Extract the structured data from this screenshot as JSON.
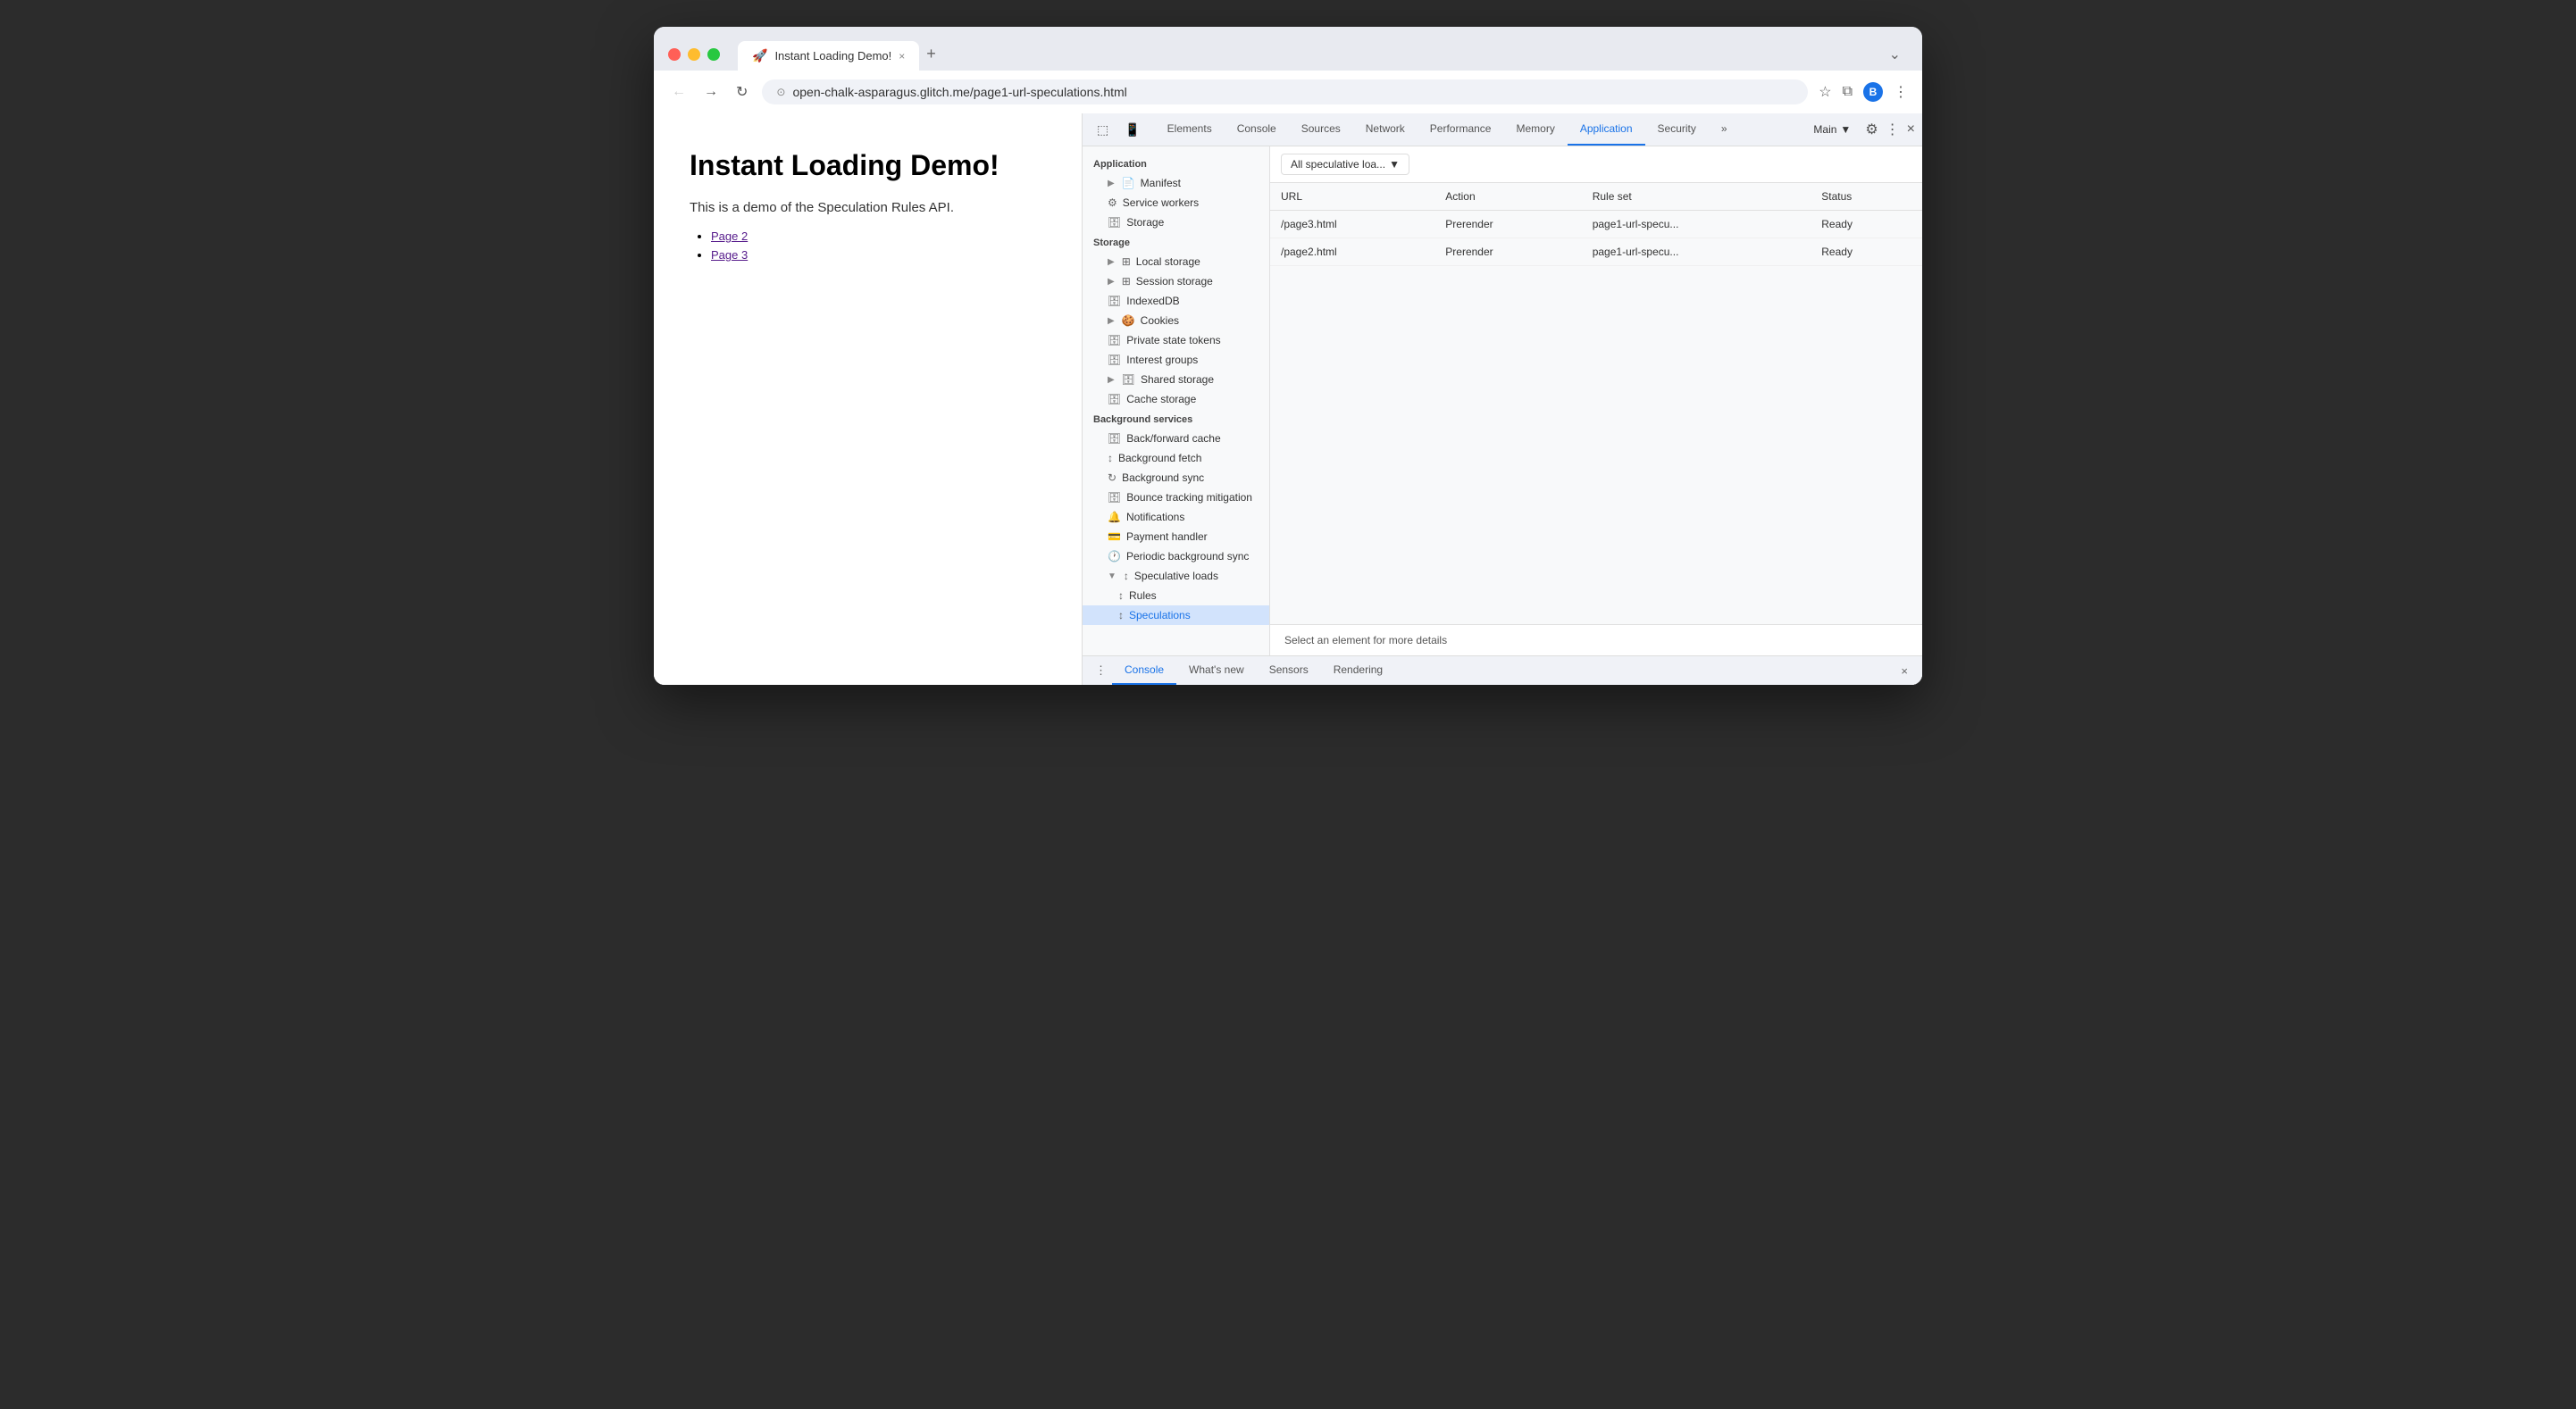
{
  "browser": {
    "tab_title": "Instant Loading Demo!",
    "tab_close": "×",
    "tab_new": "+",
    "tab_more": "⌄",
    "nav_back": "←",
    "nav_forward": "→",
    "nav_reload": "↻",
    "address_lock": "⊙",
    "address_url": "open-chalk-asparagus.glitch.me/page1-url-speculations.html",
    "star_icon": "☆",
    "ext_icon": "⧉",
    "profile_icon": "B",
    "more_icon": "⋮"
  },
  "page": {
    "title": "Instant Loading Demo!",
    "description": "This is a demo of the Speculation Rules API.",
    "links": [
      "Page 2",
      "Page 3"
    ]
  },
  "devtools": {
    "tabs": [
      {
        "label": "Elements",
        "active": false
      },
      {
        "label": "Console",
        "active": false
      },
      {
        "label": "Sources",
        "active": false
      },
      {
        "label": "Network",
        "active": false
      },
      {
        "label": "Performance",
        "active": false
      },
      {
        "label": "Memory",
        "active": false
      },
      {
        "label": "Application",
        "active": true
      },
      {
        "label": "Security",
        "active": false
      }
    ],
    "more_tabs": "»",
    "context_label": "Main",
    "settings_icon": "⚙",
    "more_icon": "⋮",
    "close_icon": "×"
  },
  "sidebar": {
    "application_section": "Application",
    "items_app": [
      {
        "label": "Manifest",
        "indent": "indent1",
        "icon": "📄",
        "expand": "▶"
      },
      {
        "label": "Service workers",
        "indent": "indent1",
        "icon": "⚙"
      },
      {
        "label": "Storage",
        "indent": "indent1",
        "icon": "🗄"
      }
    ],
    "storage_section": "Storage",
    "items_storage": [
      {
        "label": "Local storage",
        "indent": "indent1",
        "icon": "⊞",
        "expand": "▶"
      },
      {
        "label": "Session storage",
        "indent": "indent1",
        "icon": "⊞",
        "expand": "▶"
      },
      {
        "label": "IndexedDB",
        "indent": "indent1",
        "icon": "🗄"
      },
      {
        "label": "Cookies",
        "indent": "indent1",
        "icon": "🍪",
        "expand": "▶"
      },
      {
        "label": "Private state tokens",
        "indent": "indent1",
        "icon": "🗄"
      },
      {
        "label": "Interest groups",
        "indent": "indent1",
        "icon": "🗄"
      },
      {
        "label": "Shared storage",
        "indent": "indent1",
        "icon": "🗄",
        "expand": "▶"
      },
      {
        "label": "Cache storage",
        "indent": "indent1",
        "icon": "🗄"
      }
    ],
    "bg_services_section": "Background services",
    "items_bg": [
      {
        "label": "Back/forward cache",
        "indent": "indent1",
        "icon": "🗄"
      },
      {
        "label": "Background fetch",
        "indent": "indent1",
        "icon": "↕"
      },
      {
        "label": "Background sync",
        "indent": "indent1",
        "icon": "↻"
      },
      {
        "label": "Bounce tracking mitigation",
        "indent": "indent1",
        "icon": "🗄"
      },
      {
        "label": "Notifications",
        "indent": "indent1",
        "icon": "🔔"
      },
      {
        "label": "Payment handler",
        "indent": "indent1",
        "icon": "💳"
      },
      {
        "label": "Periodic background sync",
        "indent": "indent1",
        "icon": "🕐"
      },
      {
        "label": "Speculative loads",
        "indent": "indent1",
        "icon": "↕",
        "expand": "▼"
      },
      {
        "label": "Rules",
        "indent": "indent2",
        "icon": "↕"
      },
      {
        "label": "Speculations",
        "indent": "indent2",
        "icon": "↕",
        "active": true
      }
    ]
  },
  "panel": {
    "dropdown_label": "All speculative loa...",
    "dropdown_icon": "▼",
    "table_headers": [
      "URL",
      "Action",
      "Rule set",
      "Status"
    ],
    "table_rows": [
      {
        "url": "/page3.html",
        "action": "Prerender",
        "rule_set": "page1-url-specu...",
        "status": "Ready"
      },
      {
        "url": "/page2.html",
        "action": "Prerender",
        "rule_set": "page1-url-specu...",
        "status": "Ready"
      }
    ],
    "details_text": "Select an element for more details"
  },
  "drawer": {
    "menu_icon": "⋮",
    "tabs": [
      {
        "label": "Console",
        "active": true
      },
      {
        "label": "What's new",
        "active": false
      },
      {
        "label": "Sensors",
        "active": false
      },
      {
        "label": "Rendering",
        "active": false
      }
    ],
    "close_icon": "×"
  }
}
